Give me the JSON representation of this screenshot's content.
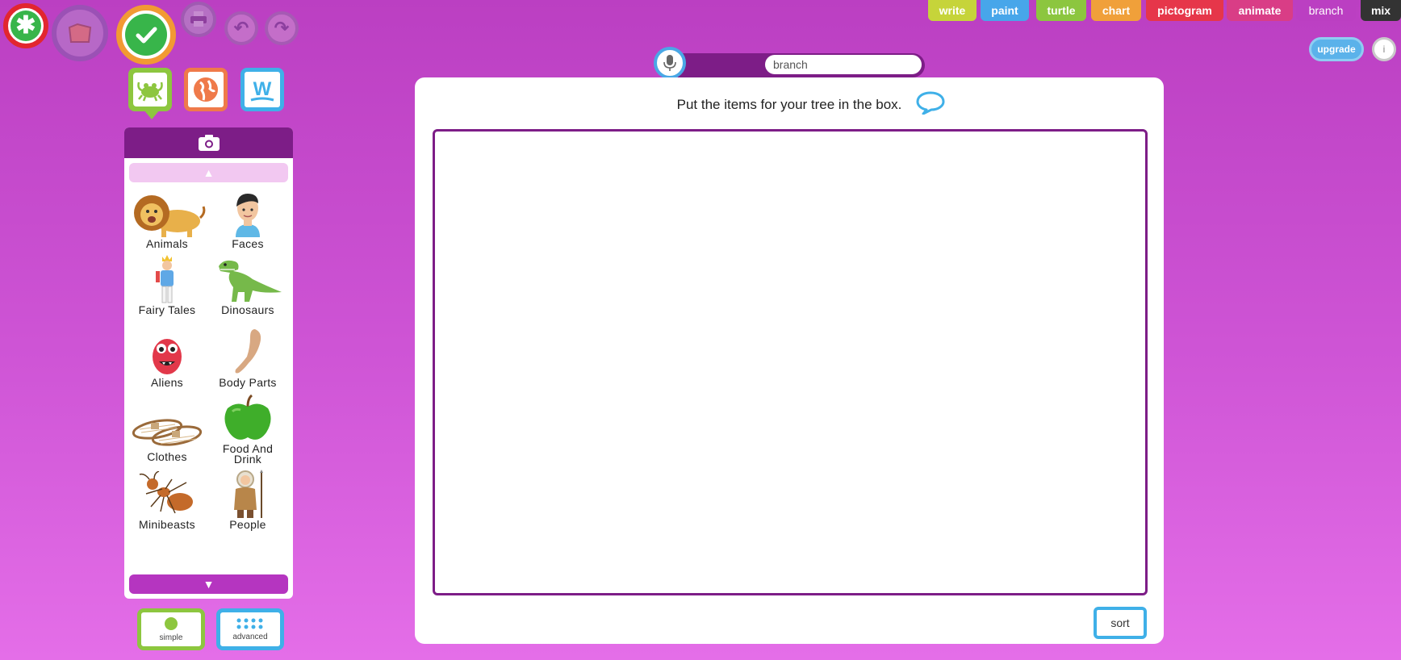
{
  "toolbar": {
    "new": "new",
    "open": "open",
    "save": "save",
    "print": "print",
    "undo": "undo",
    "redo": "redo"
  },
  "tools": [
    "clipart",
    "web",
    "word"
  ],
  "app_tabs": [
    {
      "label": "write",
      "color": "#c6d43a"
    },
    {
      "label": "paint",
      "color": "#47a6ea"
    },
    {
      "label": "turtle",
      "color": "#8cc63f"
    },
    {
      "label": "chart",
      "color": "#f0a03a"
    },
    {
      "label": "pictogram",
      "color": "#e6364a"
    },
    {
      "label": "animate",
      "color": "#d93d86"
    },
    {
      "label": "branch",
      "color": "#bb3fc2"
    },
    {
      "label": "mix",
      "color": "#333333"
    }
  ],
  "account": {
    "upgrade_label": "upgrade",
    "info_label": "i"
  },
  "search": {
    "value": "branch"
  },
  "main": {
    "instruction": "Put the items for your tree in the box.",
    "sort_label": "sort"
  },
  "clipart": {
    "categories": [
      "Animals",
      "Faces",
      "Fairy Tales",
      "Dinosaurs",
      "Aliens",
      "Body Parts",
      "Clothes",
      "Food And Drink",
      "Minibeasts",
      "People"
    ]
  },
  "modes": {
    "simple": "simple",
    "advanced": "advanced"
  },
  "colors": {
    "background": "#c94bd0",
    "panel_header": "#7d1d87",
    "accent_blue": "#3fb0e8",
    "accent_green": "#8dc63f"
  }
}
